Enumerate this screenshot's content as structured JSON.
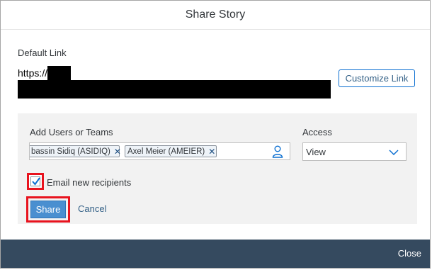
{
  "dialog": {
    "title": "Share Story"
  },
  "default_link": {
    "label": "Default Link",
    "url_prefix": "https://",
    "customize_label": "Customize Link"
  },
  "sharing": {
    "users_label": "Add Users or Teams",
    "tokens": [
      {
        "text": "bassin Sidiq (ASIDIQ)"
      },
      {
        "text": "Axel Meier (AMEIER)"
      }
    ],
    "access_label": "Access",
    "access_value": "View",
    "email_checkbox_checked": true,
    "email_label": "Email new recipients",
    "share_label": "Share",
    "cancel_label": "Cancel"
  },
  "footer": {
    "close_label": "Close"
  },
  "colors": {
    "footer_bg": "#354a5f",
    "highlight": "#e8131e",
    "share_button": "#4a8fd0",
    "link": "#346187"
  }
}
